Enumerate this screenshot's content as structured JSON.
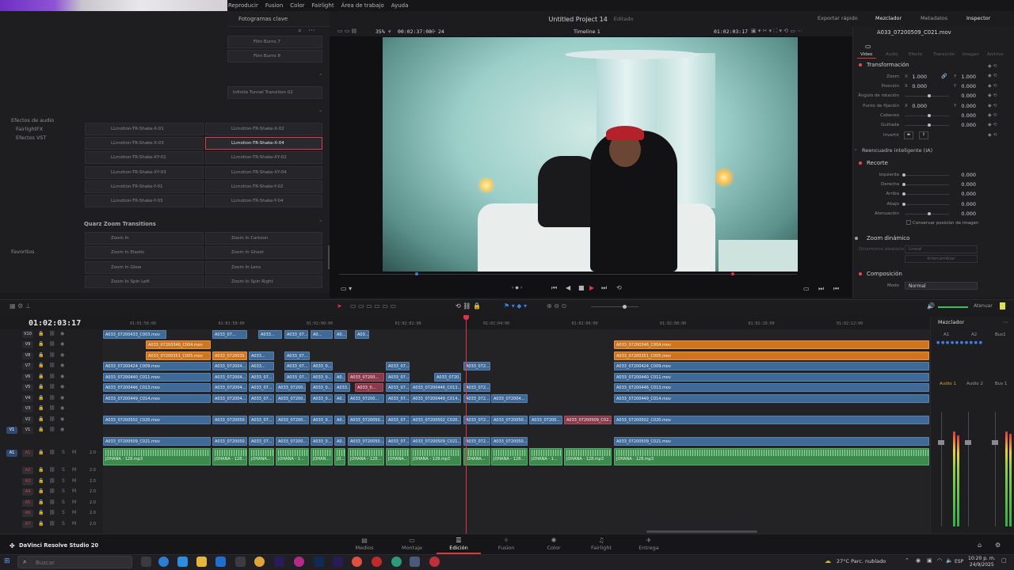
{
  "menu": [
    "Reproducir",
    "Fusion",
    "Color",
    "Fairlight",
    "Área de trabajo",
    "Ayuda"
  ],
  "effects": {
    "header": "Fotogramas clave",
    "tree": [
      "Efectos de audio",
      "FairlightFX",
      "Efectos VST"
    ],
    "favorites": "Favoritos",
    "tiles_top": [
      "Film Burns 7",
      "Film Burns 8",
      "Infinite Tunnel Transition 02"
    ],
    "tiles_left": [
      "LLmotion-TR-Shake-X-01",
      "LLmotion-TR-Shake-X-03",
      "LLmotion-TR-Shake-XY-01",
      "LLmotion-TR-Shake-XY-03",
      "LLmotion-TR-Shake-Y-01",
      "LLmotion-TR-Shake-Y-03"
    ],
    "tiles_right": [
      "LLmotion-TR-Shake-X-02",
      "LLmotion-TR-Shake-X-04",
      "LLmotion-TR-Shake-XY-02",
      "LLmotion-TR-Shake-XY-04",
      "LLmotion-TR-Shake-Y-02",
      "LLmotion-TR-Shake-Y-04"
    ],
    "selected": "LLmotion-TR-Shake-X-04",
    "section2": "Quarz Zoom Transitions",
    "zoom_left": [
      "Zoom In",
      "Zoom In Elastic",
      "Zoom In Glow",
      "Zoom In Spin Left"
    ],
    "zoom_right": [
      "Zoom In Cartoon",
      "Zoom In Ghost",
      "Zoom In Lens",
      "Zoom In Spin Right"
    ]
  },
  "viewer": {
    "project_title": "Untitled Project 14",
    "project_status": "Editado",
    "zoom": "35%",
    "timecode_in": "00:02:37:08",
    "fps": "24",
    "timeline_name": "Timeline 1",
    "timecode": "01:02:03:17"
  },
  "top_right": {
    "quick_export": "Exportar rápido",
    "mixer": "Mezclador",
    "metadata": "Metadatos",
    "inspector": "Inspector"
  },
  "inspector": {
    "clip_name": "A033_07200509_C021.mov",
    "tabs": [
      "Video",
      "Audio",
      "Efecto",
      "Transición",
      "Imagen",
      "Archivo"
    ],
    "active_tab": "Video",
    "transform_title": "Transformación",
    "zoom_label": "Zoom",
    "zoom_x": "1.000",
    "zoom_y": "1.000",
    "pos_label": "Posición",
    "pos_x": "0.000",
    "pos_y": "0.000",
    "rot_label": "Ángulo de rotación",
    "rot_val": "0.000",
    "anchor_label": "Punto de fijación",
    "anchor_x": "0.000",
    "anchor_y": "0.000",
    "pitch_label": "Cabeceo",
    "pitch_val": "0.000",
    "yaw_label": "Guiñada",
    "yaw_val": "0.000",
    "flip_label": "Invertir",
    "smart_reframe": "Reencuadre inteligente (IA)",
    "crop_title": "Recorte",
    "crop_left_label": "Izquierda",
    "crop_left": "0.000",
    "crop_right_label": "Derecha",
    "crop_right": "0.000",
    "crop_top_label": "Arriba",
    "crop_top": "0.000",
    "crop_bottom_label": "Abajo",
    "crop_bottom": "0.000",
    "soft_label": "Atenuación",
    "soft_val": "0.000",
    "retain_label": "Conservar posición de imagen",
    "dynamic_zoom": "Zoom dinámico",
    "dz_ease_label": "Dinamismo aleatorio",
    "dz_ease": "Lineal",
    "dz_swap": "Intercambiar",
    "composite_title": "Composición",
    "mode_label": "Modo",
    "mode_val": "Normal"
  },
  "timeline": {
    "timecode": "01:02:03:17",
    "ruler": [
      "01:01:56:00",
      "01:01:58:00",
      "01:02:00:00",
      "01:02:02:00",
      "01:02:04:00",
      "01:02:06:00",
      "01:02:08:00",
      "01:02:10:00",
      "01:02:12:00"
    ],
    "video_tracks": [
      "V10",
      "V9",
      "V8",
      "V7",
      "V6",
      "V5",
      "V4",
      "V3",
      "V2",
      "V1"
    ],
    "audio_tracks": [
      "A1",
      "A2",
      "A3",
      "A4",
      "A5",
      "A6",
      "A7"
    ],
    "audio_level": "2.0",
    "clips": [
      {
        "row": 0,
        "start": 0,
        "len": 80,
        "color": "blue",
        "name": "A033_07200433_C003.mov"
      },
      {
        "row": 0,
        "start": 138,
        "len": 44,
        "color": "blue",
        "name": "A033_07..."
      },
      {
        "row": 0,
        "start": 196,
        "len": 30,
        "color": "blue",
        "name": "A033..."
      },
      {
        "row": 0,
        "start": 229,
        "len": 30,
        "color": "blue",
        "name": "A033_07..."
      },
      {
        "row": 0,
        "start": 262,
        "len": 28,
        "color": "blue",
        "name": "A0..."
      },
      {
        "row": 0,
        "start": 292,
        "len": 16,
        "color": "blue",
        "name": "A0..."
      },
      {
        "row": 0,
        "start": 318,
        "len": 18,
        "color": "blue",
        "name": "A03..."
      },
      {
        "row": 1,
        "start": 54,
        "len": 82,
        "color": "orange",
        "name": "A033_07200346_C004.mov"
      },
      {
        "row": 1,
        "start": 645,
        "len": 398,
        "color": "orange",
        "name": "A033_07200346_C004.mov"
      },
      {
        "row": 2,
        "start": 54,
        "len": 82,
        "color": "orange",
        "name": "A033_07200351_C005.mov"
      },
      {
        "row": 2,
        "start": 138,
        "len": 44,
        "color": "orange",
        "name": "A033_0720035..."
      },
      {
        "row": 2,
        "start": 184,
        "len": 32,
        "color": "blue",
        "name": "A033..."
      },
      {
        "row": 2,
        "start": 229,
        "len": 32,
        "color": "blue",
        "name": "A033_07..."
      },
      {
        "row": 2,
        "start": 645,
        "len": 398,
        "color": "orange",
        "name": "A033_07200351_C005.mov"
      },
      {
        "row": 3,
        "start": 0,
        "len": 136,
        "color": "blue",
        "name": "A033_07200424_C009.mov"
      },
      {
        "row": 3,
        "start": 138,
        "len": 44,
        "color": "blue",
        "name": "A033_072004..."
      },
      {
        "row": 3,
        "start": 184,
        "len": 32,
        "color": "blue",
        "name": "A033..."
      },
      {
        "row": 3,
        "start": 229,
        "len": 32,
        "color": "blue",
        "name": "A033_07..."
      },
      {
        "row": 3,
        "start": 262,
        "len": 28,
        "color": "blue",
        "name": "A033_0..."
      },
      {
        "row": 3,
        "start": 357,
        "len": 30,
        "color": "blue",
        "name": "A033_07..."
      },
      {
        "row": 3,
        "start": 455,
        "len": 34,
        "color": "blue",
        "name": "A033_072..."
      },
      {
        "row": 3,
        "start": 645,
        "len": 398,
        "color": "blue",
        "name": "A033_07200424_C009.mov"
      },
      {
        "row": 4,
        "start": 0,
        "len": 136,
        "color": "blue",
        "name": "A033_07200440_C011.mov"
      },
      {
        "row": 4,
        "start": 138,
        "len": 44,
        "color": "blue",
        "name": "A033_072004..."
      },
      {
        "row": 4,
        "start": 184,
        "len": 32,
        "color": "blue",
        "name": "A033_07..."
      },
      {
        "row": 4,
        "start": 229,
        "len": 32,
        "color": "blue",
        "name": "A033_07..."
      },
      {
        "row": 4,
        "start": 262,
        "len": 28,
        "color": "blue",
        "name": "A033_0..."
      },
      {
        "row": 4,
        "start": 292,
        "len": 14,
        "color": "blue",
        "name": "A0..."
      },
      {
        "row": 4,
        "start": 309,
        "len": 46,
        "color": "red",
        "name": "A033_07200..."
      },
      {
        "row": 4,
        "start": 357,
        "len": 30,
        "color": "blue",
        "name": "A033_07..."
      },
      {
        "row": 4,
        "start": 418,
        "len": 34,
        "color": "blue",
        "name": "A033_0720..."
      },
      {
        "row": 4,
        "start": 645,
        "len": 398,
        "color": "blue",
        "name": "A033_07200440_C011.mov"
      },
      {
        "row": 5,
        "start": 0,
        "len": 136,
        "color": "blue",
        "name": "A033_07200446_C013.mov"
      },
      {
        "row": 5,
        "start": 138,
        "len": 44,
        "color": "blue",
        "name": "A033_072004..."
      },
      {
        "row": 5,
        "start": 184,
        "len": 32,
        "color": "blue",
        "name": "A033_07..."
      },
      {
        "row": 5,
        "start": 218,
        "len": 38,
        "color": "blue",
        "name": "A033_07200..."
      },
      {
        "row": 5,
        "start": 262,
        "len": 28,
        "color": "blue",
        "name": "A033_0..."
      },
      {
        "row": 5,
        "start": 292,
        "len": 20,
        "color": "blue",
        "name": "A033..."
      },
      {
        "row": 5,
        "start": 318,
        "len": 36,
        "color": "red",
        "name": "A033_0..."
      },
      {
        "row": 5,
        "start": 357,
        "len": 30,
        "color": "blue",
        "name": "A033_07..."
      },
      {
        "row": 5,
        "start": 388,
        "len": 64,
        "color": "blue",
        "name": "A033_07200446_C013..."
      },
      {
        "row": 5,
        "start": 455,
        "len": 34,
        "color": "blue",
        "name": "A033_072..."
      },
      {
        "row": 5,
        "start": 645,
        "len": 398,
        "color": "blue",
        "name": "A033_07200446_C013.mov"
      },
      {
        "row": 6,
        "start": 0,
        "len": 136,
        "color": "blue",
        "name": "A033_07200449_C014.mov"
      },
      {
        "row": 6,
        "start": 138,
        "len": 44,
        "color": "blue",
        "name": "A033_072004..."
      },
      {
        "row": 6,
        "start": 184,
        "len": 32,
        "color": "blue",
        "name": "A033_07..."
      },
      {
        "row": 6,
        "start": 218,
        "len": 38,
        "color": "blue",
        "name": "A033_07200..."
      },
      {
        "row": 6,
        "start": 262,
        "len": 28,
        "color": "blue",
        "name": "A033_0..."
      },
      {
        "row": 6,
        "start": 292,
        "len": 14,
        "color": "blue",
        "name": "A0..."
      },
      {
        "row": 6,
        "start": 309,
        "len": 46,
        "color": "blue",
        "name": "A033_07200..."
      },
      {
        "row": 6,
        "start": 357,
        "len": 30,
        "color": "blue",
        "name": "A033_07..."
      },
      {
        "row": 6,
        "start": 388,
        "len": 64,
        "color": "blue",
        "name": "A033_07200449_C014..."
      },
      {
        "row": 6,
        "start": 455,
        "len": 34,
        "color": "blue",
        "name": "A033_072..."
      },
      {
        "row": 6,
        "start": 490,
        "len": 46,
        "color": "blue",
        "name": "A033_072004..."
      },
      {
        "row": 6,
        "start": 645,
        "len": 398,
        "color": "blue",
        "name": "A033_07200449_C014.mov"
      },
      {
        "row": 8,
        "start": 0,
        "len": 136,
        "color": "blue",
        "name": "A033_07200502_C020.mov"
      },
      {
        "row": 8,
        "start": 138,
        "len": 44,
        "color": "blue",
        "name": "A033_0720050..."
      },
      {
        "row": 8,
        "start": 184,
        "len": 32,
        "color": "blue",
        "name": "A033_07..."
      },
      {
        "row": 8,
        "start": 218,
        "len": 42,
        "color": "blue",
        "name": "A033_07200..."
      },
      {
        "row": 8,
        "start": 262,
        "len": 28,
        "color": "blue",
        "name": "A033_0..."
      },
      {
        "row": 8,
        "start": 292,
        "len": 14,
        "color": "blue",
        "name": "A0..."
      },
      {
        "row": 8,
        "start": 309,
        "len": 46,
        "color": "blue",
        "name": "A033_0720050..."
      },
      {
        "row": 8,
        "start": 357,
        "len": 30,
        "color": "blue",
        "name": "A033_07..."
      },
      {
        "row": 8,
        "start": 388,
        "len": 64,
        "color": "blue",
        "name": "A033_07200502_C020..."
      },
      {
        "row": 8,
        "start": 455,
        "len": 34,
        "color": "blue",
        "name": "A033_072..."
      },
      {
        "row": 8,
        "start": 490,
        "len": 46,
        "color": "blue",
        "name": "A033_0720050..."
      },
      {
        "row": 8,
        "start": 538,
        "len": 42,
        "color": "blue",
        "name": "A033_07200..."
      },
      {
        "row": 8,
        "start": 582,
        "len": 60,
        "color": "red",
        "name": "A033_07200509_C02..."
      },
      {
        "row": 8,
        "start": 645,
        "len": 398,
        "color": "blue",
        "name": "A033_07200502_C020.mov"
      },
      {
        "row": 10,
        "start": 0,
        "len": 136,
        "color": "blue",
        "name": "A033_07200509_C021.mov"
      },
      {
        "row": 10,
        "start": 138,
        "len": 44,
        "color": "blue",
        "name": "A033_0720050..."
      },
      {
        "row": 10,
        "start": 184,
        "len": 32,
        "color": "blue",
        "name": "A033_07..."
      },
      {
        "row": 10,
        "start": 218,
        "len": 42,
        "color": "blue",
        "name": "A033_07200..."
      },
      {
        "row": 10,
        "start": 262,
        "len": 28,
        "color": "blue",
        "name": "A033_0..."
      },
      {
        "row": 10,
        "start": 292,
        "len": 14,
        "color": "blue",
        "name": "A0..."
      },
      {
        "row": 10,
        "start": 309,
        "len": 46,
        "color": "blue",
        "name": "A033_0720050..."
      },
      {
        "row": 10,
        "start": 357,
        "len": 30,
        "color": "blue",
        "name": "A033_07..."
      },
      {
        "row": 10,
        "start": 388,
        "len": 64,
        "color": "blue",
        "name": "A033_07200509_C021..."
      },
      {
        "row": 10,
        "start": 455,
        "len": 34,
        "color": "blue",
        "name": "A033_072..."
      },
      {
        "row": 10,
        "start": 490,
        "len": 46,
        "color": "blue",
        "name": "A033_0720050..."
      },
      {
        "row": 10,
        "start": 645,
        "len": 398,
        "color": "blue",
        "name": "A033_07200509_C021.mov"
      }
    ],
    "audio_clips": [
      {
        "start": 0,
        "len": 136,
        "name": "JOHANA - 128.mp3"
      },
      {
        "start": 138,
        "len": 44,
        "name": "JOHANA - 128..."
      },
      {
        "start": 184,
        "len": 32,
        "name": "JOHANA..."
      },
      {
        "start": 218,
        "len": 42,
        "name": "JOHANA - 1..."
      },
      {
        "start": 262,
        "len": 28,
        "name": "JOHAN..."
      },
      {
        "start": 292,
        "len": 14,
        "name": "JO..."
      },
      {
        "start": 309,
        "len": 46,
        "name": "JOHANA - 128..."
      },
      {
        "start": 357,
        "len": 30,
        "name": "JOHANA..."
      },
      {
        "start": 388,
        "len": 64,
        "name": "JOHANA - 128.mp3"
      },
      {
        "start": 455,
        "len": 34,
        "name": "JOHANA..."
      },
      {
        "start": 490,
        "len": 46,
        "name": "JOHANA - 128..."
      },
      {
        "start": 538,
        "len": 42,
        "name": "JOHANA - 1..."
      },
      {
        "start": 582,
        "len": 60,
        "name": "JOHANA - 128.mp3"
      },
      {
        "start": 645,
        "len": 398,
        "name": "JOHANA - 128.mp3"
      }
    ]
  },
  "mixer": {
    "title": "Mezclador",
    "cols": [
      "A1",
      "A2",
      "Bus1"
    ],
    "strips": [
      "Audio 1",
      "Audio 2",
      "Bus 1"
    ],
    "atenuar": "Atenuar"
  },
  "pages": {
    "brand": "DaVinci Resolve Studio 20",
    "tabs": [
      "Medios",
      "Montaje",
      "Edición",
      "Fusion",
      "Color",
      "Fairlight",
      "Entrega"
    ],
    "active": "Edición"
  },
  "taskbar": {
    "search_placeholder": "Buscar",
    "weather": "27°C  Parc. nublado",
    "lang": "ESP",
    "time": "10:20 p. m.",
    "date": "24/9/2025"
  },
  "colors": {
    "accent_red": "#e0343f",
    "clip_blue": "#3f6a97",
    "clip_orange": "#d0741e",
    "clip_green": "#3c8a4e"
  }
}
